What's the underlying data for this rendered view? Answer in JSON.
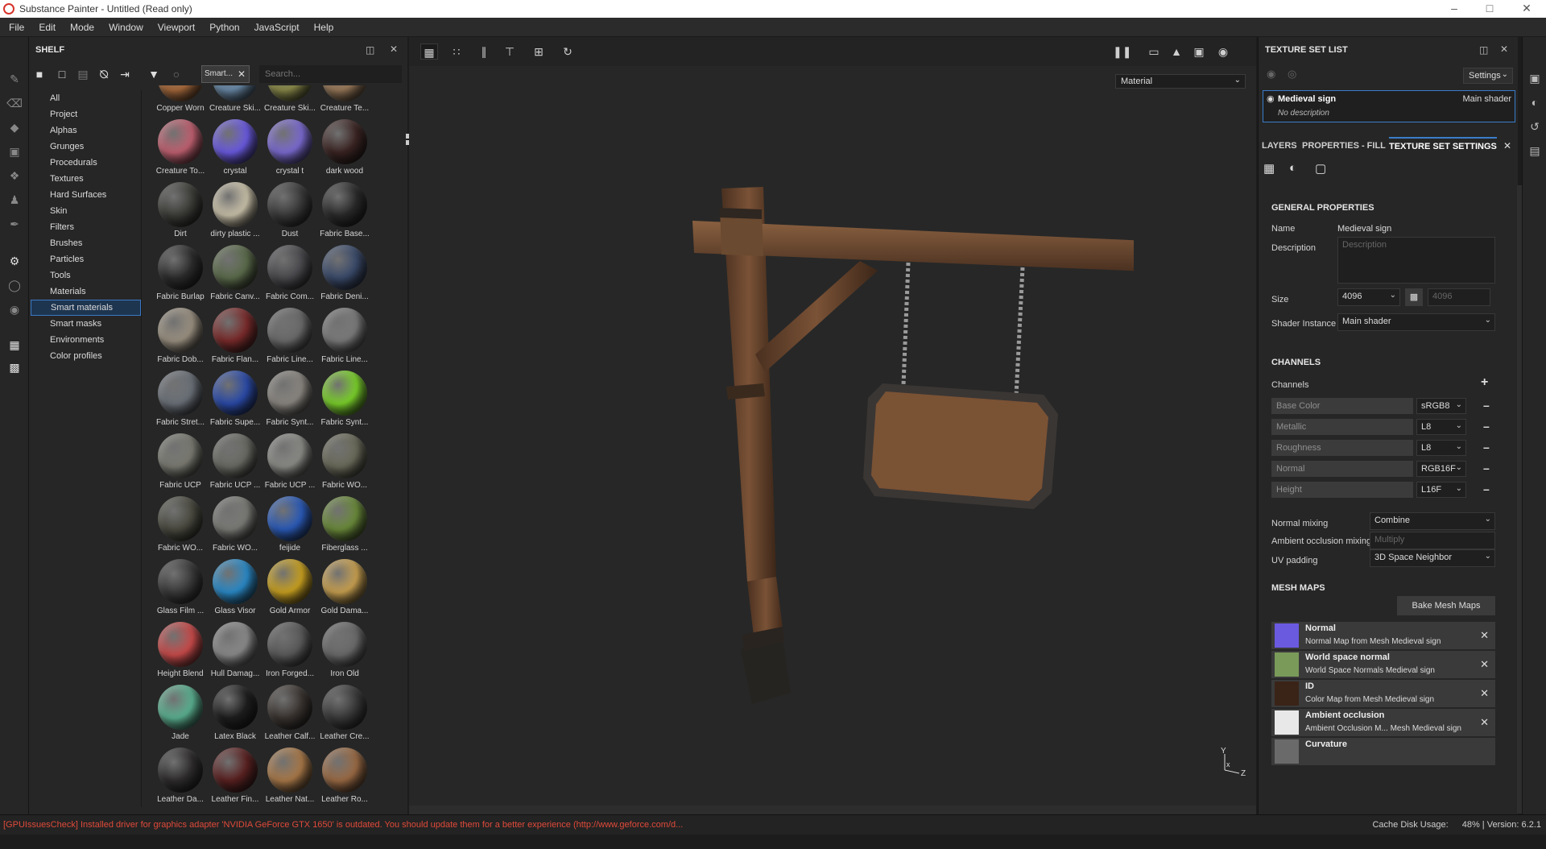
{
  "window": {
    "title": "Substance Painter - Untitled (Read only)"
  },
  "menu": [
    "File",
    "Edit",
    "Mode",
    "Window",
    "Viewport",
    "Python",
    "JavaScript",
    "Help"
  ],
  "shelf": {
    "title": "SHELF",
    "filter_chip": "Smart...",
    "search_placeholder": "Search...",
    "categories": [
      "All",
      "Project",
      "Alphas",
      "Grunges",
      "Procedurals",
      "Textures",
      "Hard Surfaces",
      "Skin",
      "Filters",
      "Brushes",
      "Particles",
      "Tools",
      "Materials",
      "Smart materials",
      "Smart masks",
      "Environments",
      "Color profiles"
    ],
    "selected_category": "Smart materials",
    "materials": [
      {
        "label": "Copper Worn",
        "color": "#a86a3c"
      },
      {
        "label": "Creature Ski...",
        "color": "#6a8aa8"
      },
      {
        "label": "Creature Ski...",
        "color": "#8a8a4a"
      },
      {
        "label": "Creature Te...",
        "color": "#9a7a5a"
      },
      {
        "label": "Creature To...",
        "color": "#c06070"
      },
      {
        "label": "crystal",
        "color": "#6a5ae0"
      },
      {
        "label": "crystal t",
        "color": "#7a6ad0"
      },
      {
        "label": "dark wood",
        "color": "#3a2422"
      },
      {
        "label": "Dirt",
        "color": "#3c3c38"
      },
      {
        "label": "dirty plastic ...",
        "color": "#c8c0a8"
      },
      {
        "label": "Dust",
        "color": "#3a3a3a"
      },
      {
        "label": "Fabric Base...",
        "color": "#2a2a2a"
      },
      {
        "label": "Fabric Burlap",
        "color": "#2c2c2c"
      },
      {
        "label": "Fabric Canv...",
        "color": "#5a6a4a"
      },
      {
        "label": "Fabric Com...",
        "color": "#4a4a4e"
      },
      {
        "label": "Fabric Deni...",
        "color": "#3a4a6a"
      },
      {
        "label": "Fabric Dob...",
        "color": "#9a9080"
      },
      {
        "label": "Fabric Flan...",
        "color": "#7a2a2a"
      },
      {
        "label": "Fabric Line...",
        "color": "#6a6a6a"
      },
      {
        "label": "Fabric Line...",
        "color": "#7a7a7a"
      },
      {
        "label": "Fabric Stret...",
        "color": "#6a7078"
      },
      {
        "label": "Fabric Supe...",
        "color": "#2a4aa8"
      },
      {
        "label": "Fabric Synt...",
        "color": "#8a8680"
      },
      {
        "label": "Fabric Synt...",
        "color": "#7ad02a"
      },
      {
        "label": "Fabric UCP",
        "color": "#7a7a72"
      },
      {
        "label": "Fabric UCP ...",
        "color": "#6a6a64"
      },
      {
        "label": "Fabric UCP ...",
        "color": "#8a8a86"
      },
      {
        "label": "Fabric WO...",
        "color": "#6a6a5a"
      },
      {
        "label": "Fabric WO...",
        "color": "#4a4a40"
      },
      {
        "label": "Fabric WO...",
        "color": "#7a7a76"
      },
      {
        "label": "feijide",
        "color": "#2a5ab8"
      },
      {
        "label": "Fiberglass ...",
        "color": "#6a8a3a"
      },
      {
        "label": "Glass Film ...",
        "color": "#3a3a3a"
      },
      {
        "label": "Glass Visor",
        "color": "#2a8ac8"
      },
      {
        "label": "Gold Armor",
        "color": "#c8a020"
      },
      {
        "label": "Gold Dama...",
        "color": "#c8a050"
      },
      {
        "label": "Height Blend",
        "color": "#c84a4a"
      },
      {
        "label": "Hull Damag...",
        "color": "#8a8a8a"
      },
      {
        "label": "Iron Forged...",
        "color": "#5a5a5a"
      },
      {
        "label": "Iron Old",
        "color": "#6a6a6a"
      },
      {
        "label": "Jade",
        "color": "#5ab090"
      },
      {
        "label": "Latex Black",
        "color": "#1e1e1e"
      },
      {
        "label": "Leather Calf...",
        "color": "#3a3430"
      },
      {
        "label": "Leather Cre...",
        "color": "#3a3a3a"
      },
      {
        "label": "Leather Da...",
        "color": "#2e2c2c"
      },
      {
        "label": "Leather Fin...",
        "color": "#5a2020"
      },
      {
        "label": "Leather Nat...",
        "color": "#a87848"
      },
      {
        "label": "Leather Ro...",
        "color": "#9a6a44"
      }
    ]
  },
  "viewport": {
    "mode_dropdown": "Material",
    "axis_y": "Y",
    "axis_x": "x",
    "axis_z": "Z"
  },
  "texture_set_list": {
    "title": "TEXTURE SET LIST",
    "settings_label": "Settings",
    "item_name": "Medieval sign",
    "item_shader": "Main shader",
    "item_description": "No description"
  },
  "tabs": [
    "LAYERS",
    "PROPERTIES - FILL",
    "TEXTURE SET SETTINGS"
  ],
  "tss": {
    "general_header": "GENERAL PROPERTIES",
    "name_label": "Name",
    "name_value": "Medieval sign",
    "description_label": "Description",
    "description_placeholder": "Description",
    "size_label": "Size",
    "size_value": "4096",
    "size_locked_value": "4096",
    "shader_label": "Shader Instance",
    "shader_value": "Main shader",
    "channels_header": "CHANNELS",
    "channels_label": "Channels",
    "channels": [
      {
        "name": "Base Color",
        "format": "sRGB8"
      },
      {
        "name": "Metallic",
        "format": "L8"
      },
      {
        "name": "Roughness",
        "format": "L8"
      },
      {
        "name": "Normal",
        "format": "RGB16F"
      },
      {
        "name": "Height",
        "format": "L16F"
      }
    ],
    "normal_mixing_label": "Normal mixing",
    "normal_mixing_value": "Combine",
    "ao_mixing_label": "Ambient occlusion mixing",
    "ao_mixing_value": "Multiply",
    "uv_padding_label": "UV padding",
    "uv_padding_value": "3D Space Neighbor",
    "mesh_maps_header": "MESH MAPS",
    "bake_button": "Bake Mesh Maps",
    "mesh_maps": [
      {
        "title": "Normal",
        "sub": "Normal Map from Mesh Medieval sign",
        "color": "#6a5ae0"
      },
      {
        "title": "World space normal",
        "sub": "World Space Normals Medieval sign",
        "color": "#7a9a5a"
      },
      {
        "title": "ID",
        "sub": "Color Map from Mesh Medieval sign",
        "color": "#3a2418"
      },
      {
        "title": "Ambient occlusion",
        "sub": "Ambient Occlusion M... Mesh Medieval sign",
        "color": "#e8e8e8"
      },
      {
        "title": "Curvature",
        "sub": "",
        "color": "#6a6a6a"
      }
    ]
  },
  "status": {
    "message": "[GPUIssuesCheck] Installed driver for graphics adapter 'NVIDIA GeForce GTX 1650' is outdated. You should update them for a better experience (http://www.geforce.com/d...",
    "cache_label": "Cache Disk Usage:",
    "cache_value": "48%",
    "version": "Version: 6.2.1"
  },
  "colors": {
    "accent": "#3a7dc9",
    "status_error": "#e04a3a",
    "wood": "#6e4a30"
  }
}
